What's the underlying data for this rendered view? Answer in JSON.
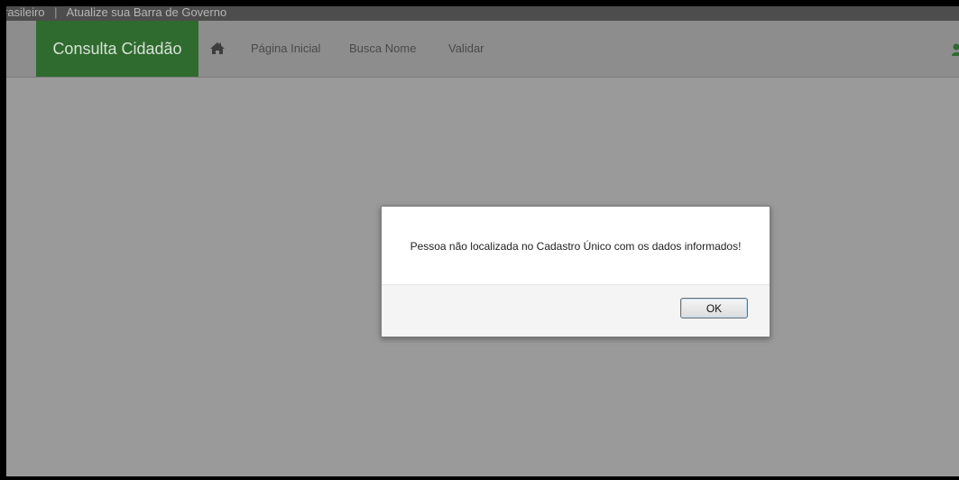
{
  "gov_bar": {
    "left_text": "rasileiro",
    "separator": "|",
    "update_link": "Atualize sua Barra de Governo"
  },
  "navbar": {
    "brand": "Consulta Cidadão",
    "home_icon": "home-icon",
    "items": [
      {
        "label": "Página Inicial"
      },
      {
        "label": "Busca Nome"
      },
      {
        "label": "Validar"
      }
    ],
    "user_icon": "user-icon"
  },
  "dialog": {
    "message": "Pessoa não localizada no Cadastro Único com os dados informados!",
    "ok_label": "OK"
  },
  "colors": {
    "brand_green": "#2f6a2f",
    "overlay_gray": "#9a9a9a",
    "gov_bar": "#4d4d4d"
  }
}
